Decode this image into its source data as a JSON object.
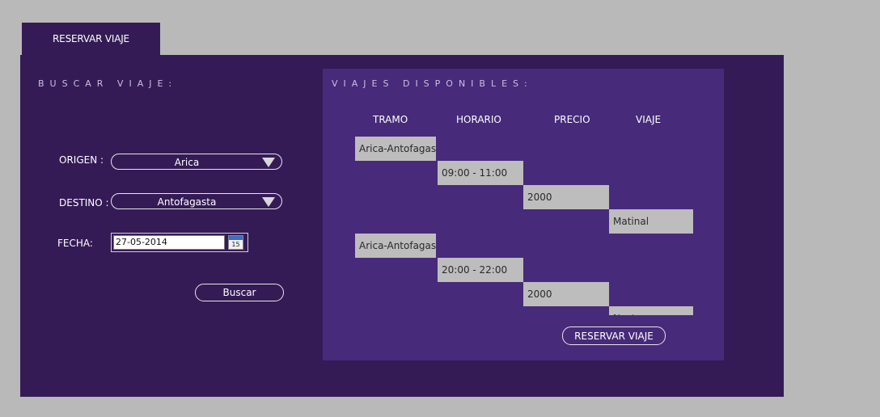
{
  "tab": {
    "label": "RESERVAR VIAJE"
  },
  "search": {
    "title": "BUSCAR VIAJE:",
    "origin_label": "ORIGEN :",
    "origin_value": "Arica",
    "destination_label": "DESTINO :",
    "destination_value": "Antofagasta",
    "date_label": "FECHA:",
    "date_value": "27-05-2014",
    "calendar_day": "15",
    "search_button": "Buscar"
  },
  "results": {
    "title": "VIAJES DISPONIBLES:",
    "columns": [
      "TRAMO",
      "HORARIO",
      "PRECIO",
      "VIAJE"
    ],
    "rows": [
      {
        "tramo": "Arica-Antofagasta",
        "horario": "09:00 - 11:00",
        "precio": "2000",
        "viaje": "Matinal"
      },
      {
        "tramo": "Arica-Antofagasta",
        "horario": "20:00 - 22:00",
        "precio": "2000",
        "viaje": "Nocturno"
      }
    ],
    "reserve_button": "RESERVAR VIAJE"
  },
  "colors": {
    "background": "#b9b9b9",
    "panel": "#351b56",
    "results_panel": "#472a7a",
    "cell": "#bdbdbd"
  }
}
